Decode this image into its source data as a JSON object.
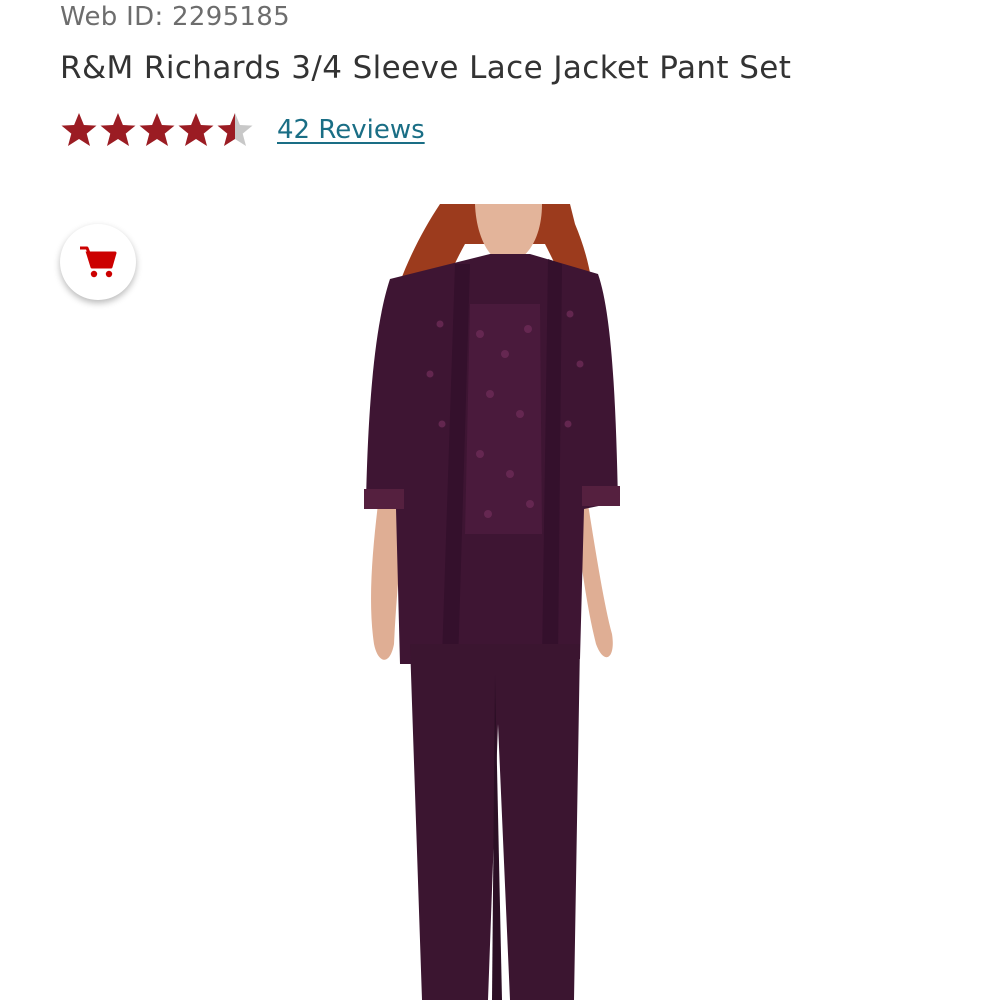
{
  "product": {
    "web_id": "Web ID: 2295185",
    "title": "R&M Richards 3/4 Sleeve Lace Jacket Pant Set",
    "rating": {
      "value": 4.5,
      "max": 5,
      "star_color": "#9b1c23",
      "empty_color": "#c8c8c8",
      "reviews_text": "42 Reviews",
      "link_color": "#1a6e85"
    },
    "cart": {
      "icon": "shopping-cart-icon",
      "icon_color": "#cc0000"
    },
    "image": {
      "subject_color": "#3b1530"
    }
  }
}
